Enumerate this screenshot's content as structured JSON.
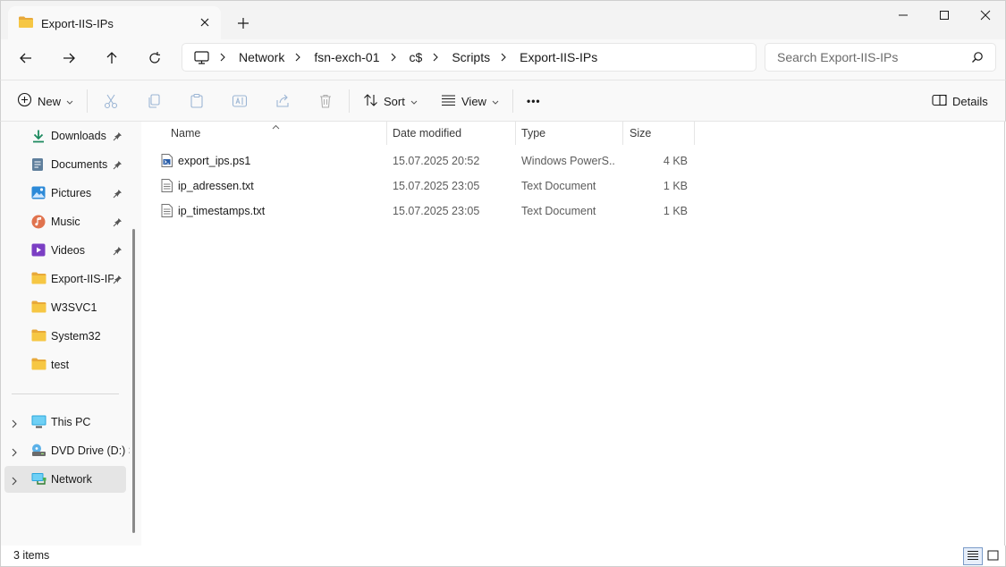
{
  "window": {
    "tab_title": "Export-IIS-IPs",
    "new_tab": "+"
  },
  "breadcrumb": [
    "Network",
    "fsn-exch-01",
    "c$",
    "Scripts",
    "Export-IIS-IPs"
  ],
  "search": {
    "placeholder": "Search Export-IIS-IPs"
  },
  "toolbar": {
    "new_label": "New",
    "sort_label": "Sort",
    "view_label": "View",
    "more_label": "•••",
    "details_label": "Details"
  },
  "sidebar": {
    "quick_access": [
      {
        "label": "Downloads",
        "icon": "download-icon",
        "pinned": true
      },
      {
        "label": "Documents",
        "icon": "documents-icon",
        "pinned": true
      },
      {
        "label": "Pictures",
        "icon": "pictures-icon",
        "pinned": true
      },
      {
        "label": "Music",
        "icon": "music-icon",
        "pinned": true
      },
      {
        "label": "Videos",
        "icon": "videos-icon",
        "pinned": true
      },
      {
        "label": "Export-IIS-IPs",
        "icon": "folder-icon",
        "pinned": true
      },
      {
        "label": "W3SVC1",
        "icon": "folder-icon",
        "pinned": false
      },
      {
        "label": "System32",
        "icon": "folder-icon",
        "pinned": false
      },
      {
        "label": "test",
        "icon": "folder-icon",
        "pinned": false
      }
    ],
    "locations": [
      {
        "label": "This PC",
        "icon": "this-pc-icon"
      },
      {
        "label": "DVD Drive (D:) S",
        "icon": "dvd-drive-icon"
      },
      {
        "label": "Network",
        "icon": "network-icon",
        "selected": true
      }
    ]
  },
  "columns": {
    "name": "Name",
    "date": "Date modified",
    "type": "Type",
    "size": "Size"
  },
  "files": [
    {
      "name": "export_ips.ps1",
      "date": "15.07.2025 20:52",
      "type": "Windows PowerS...",
      "size": "4 KB",
      "icon": "powershell-file-icon"
    },
    {
      "name": "ip_adressen.txt",
      "date": "15.07.2025 23:05",
      "type": "Text Document",
      "size": "1 KB",
      "icon": "text-file-icon"
    },
    {
      "name": "ip_timestamps.txt",
      "date": "15.07.2025 23:05",
      "type": "Text Document",
      "size": "1 KB",
      "icon": "text-file-icon"
    }
  ],
  "status": {
    "item_count": "3 items"
  },
  "colors": {
    "folder": "#f4c141",
    "selected_bg": "#e5e5e5",
    "accent": "#0067c0"
  }
}
